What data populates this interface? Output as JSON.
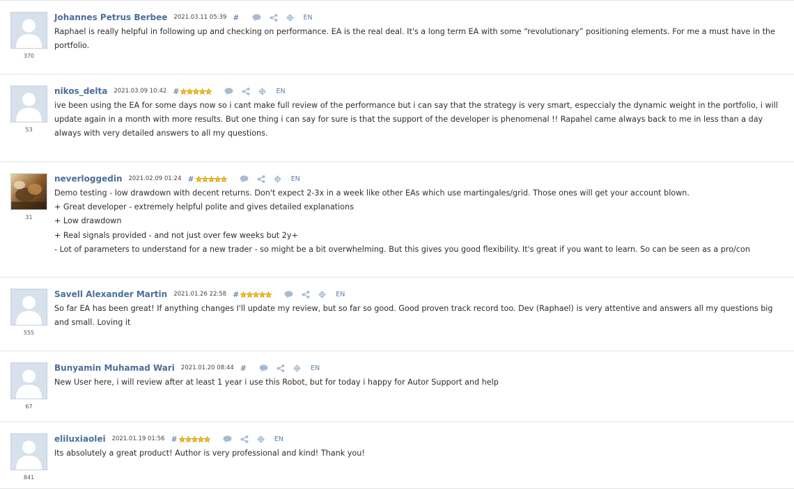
{
  "colors": {
    "author": "#4a6e9a",
    "star": "#f2b705",
    "icon": "#a9bdd4",
    "divider": "#e3e3e3"
  },
  "icons": {
    "reply": "speech-bubble-icon",
    "share": "share-icon",
    "translate": "crosshair-icon"
  },
  "reviews": [
    {
      "author": "Johannes Petrus Berbee",
      "date": "2021.03.11 05:39",
      "hash": "#",
      "stars": 0,
      "rating": "370",
      "lang": "EN",
      "avatar": "default",
      "text": "Raphael is really helpful in following up and checking on performance. EA is the real deal. It's a long term EA with some “revolutionary” positioning elements. For me a must have in the portfolio."
    },
    {
      "author": "nikos_delta",
      "date": "2021.03.09 10:42",
      "hash": "#",
      "stars": 5,
      "rating": "53",
      "lang": "EN",
      "avatar": "default",
      "text": "ive been using the EA for some days now so i cant make full review of the performance but i can say that the strategy is very smart, especcialy the dynamic weight in the portfolio, i will update again in a month with more results. But one thing i can say for sure is that the support of the developer is phenomenal !! Rapahel came always back to me in less than a day always with very detailed answers to all my questions."
    },
    {
      "author": "neverloggedin",
      "date": "2021.02.09 01:24",
      "hash": "#",
      "stars": 5,
      "rating": "31",
      "lang": "EN",
      "avatar": "photo",
      "text": "Demo testing - low drawdown with decent returns. Don't expect 2-3x in a week like other EAs which use martingales/grid. Those ones will get your account blown.\n+ Great developer - extremely helpful polite and gives detailed explanations\n+ Low drawdown\n+ Real signals provided - and not just over few weeks but 2y+\n- Lot of parameters to understand for a new trader - so might be a bit overwhelming. But this gives you good flexibility. It's great if you want to learn. So can be seen as a pro/con"
    },
    {
      "author": "Savell Alexander Martin",
      "date": "2021.01.26 22:58",
      "hash": "#",
      "stars": 5,
      "rating": "555",
      "lang": "EN",
      "avatar": "default",
      "text": "So far EA has been great! If anything changes I'll update my review, but so far so good. Good proven track record too. Dev (Raphael) is very attentive and answers all my questions big and small. Loving it"
    },
    {
      "author": "Bunyamin Muhamad Wari",
      "date": "2021.01.20 08:44",
      "hash": "#",
      "stars": 0,
      "rating": "67",
      "lang": "EN",
      "avatar": "default",
      "text": "New User here, i will review after at least 1 year i use this Robot, but for today i happy for Autor Support and help"
    },
    {
      "author": "eliluxiaolei",
      "date": "2021.01.19 01:56",
      "hash": "#",
      "stars": 5,
      "rating": "841",
      "lang": "EN",
      "avatar": "default",
      "text": "Its absolutely a great product! Author is very professional and kind! Thank you!"
    }
  ]
}
